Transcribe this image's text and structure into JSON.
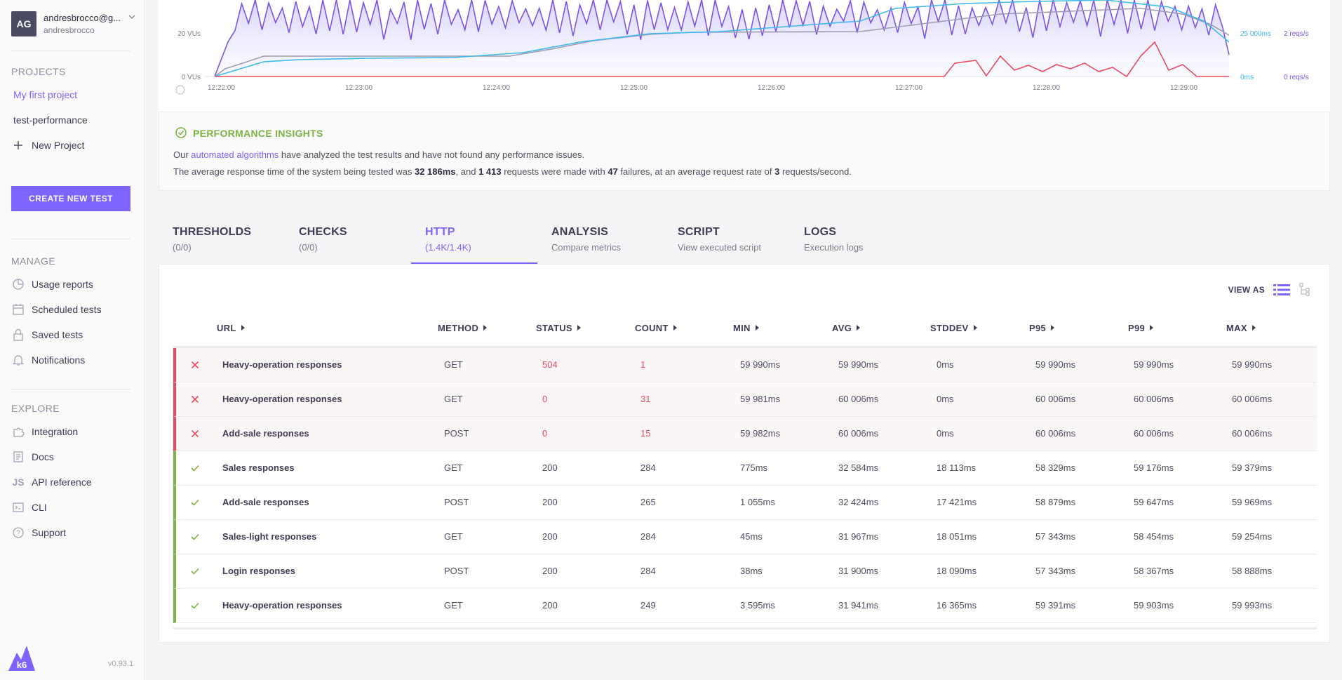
{
  "user": {
    "initials": "AG",
    "email": "andresbrocco@g...",
    "username": "andresbrocco"
  },
  "sidebar": {
    "projects_title": "PROJECTS",
    "projects": [
      {
        "label": "My first project",
        "active": true
      },
      {
        "label": "test-performance",
        "active": false
      }
    ],
    "new_project": "New Project",
    "create_button": "CREATE NEW TEST",
    "manage_title": "MANAGE",
    "manage": [
      {
        "label": "Usage reports",
        "icon": "usage-reports-icon"
      },
      {
        "label": "Scheduled tests",
        "icon": "calendar-icon"
      },
      {
        "label": "Saved tests",
        "icon": "lock-icon"
      },
      {
        "label": "Notifications",
        "icon": "bell-icon"
      }
    ],
    "explore_title": "EXPLORE",
    "explore": [
      {
        "label": "Integration",
        "icon": "puzzle-icon"
      },
      {
        "label": "Docs",
        "icon": "docs-icon"
      },
      {
        "label": "API reference",
        "icon": "js-icon"
      },
      {
        "label": "CLI",
        "icon": "terminal-icon"
      },
      {
        "label": "Support",
        "icon": "question-icon"
      }
    ],
    "version": "v0.93.1",
    "logo_text": "k6"
  },
  "chart": {
    "y_left_ticks": [
      "20 VUs",
      "0 VUs"
    ],
    "x_ticks": [
      "12:22:00",
      "12:23:00",
      "12:24:00",
      "12:25:00",
      "12:26:00",
      "12:27:00",
      "12:28:00",
      "12:29:00"
    ],
    "right_ticks_ms": [
      "25 000ms",
      "0ms"
    ],
    "right_ticks_reqs": [
      "2 reqs/s",
      "0 reqs/s"
    ],
    "colors": {
      "vus": "#9e9cae",
      "response_time": "#3fb8f0",
      "reqs": "#7d52e8",
      "failures": "#e84b5f"
    }
  },
  "insights": {
    "title": "PERFORMANCE INSIGHTS",
    "line1_pre": "Our ",
    "line1_link": "automated algorithms",
    "line1_post": " have analyzed the test results and have not found any performance issues.",
    "line2_a": "The average response time of the system being tested was ",
    "line2_b": "32 186ms",
    "line2_c": ", and ",
    "line2_d": "1 413",
    "line2_e": " requests were made with ",
    "line2_f": "47",
    "line2_g": " failures, at an average request rate of ",
    "line2_h": "3",
    "line2_i": " requests/second."
  },
  "tabs": [
    {
      "title": "THRESHOLDS",
      "sub": "(0/0)"
    },
    {
      "title": "CHECKS",
      "sub": "(0/0)"
    },
    {
      "title": "HTTP",
      "sub": "(1.4K/1.4K)"
    },
    {
      "title": "ANALYSIS",
      "sub": "Compare metrics"
    },
    {
      "title": "SCRIPT",
      "sub": "View executed script"
    },
    {
      "title": "LOGS",
      "sub": "Execution logs"
    }
  ],
  "table": {
    "view_as": "VIEW AS",
    "columns": [
      "URL",
      "METHOD",
      "STATUS",
      "COUNT",
      "MIN",
      "AVG",
      "STDDEV",
      "P95",
      "P99",
      "MAX"
    ],
    "rows": [
      {
        "ok": false,
        "url": "Heavy-operation responses",
        "method": "GET",
        "status": "504",
        "count": "1",
        "min": "59 990ms",
        "avg": "59 990ms",
        "stddev": "0ms",
        "p95": "59 990ms",
        "p99": "59 990ms",
        "max": "59 990ms"
      },
      {
        "ok": false,
        "url": "Heavy-operation responses",
        "method": "GET",
        "status": "0",
        "count": "31",
        "min": "59 981ms",
        "avg": "60 006ms",
        "stddev": "0ms",
        "p95": "60 006ms",
        "p99": "60 006ms",
        "max": "60 006ms"
      },
      {
        "ok": false,
        "url": "Add-sale responses",
        "method": "POST",
        "status": "0",
        "count": "15",
        "min": "59 982ms",
        "avg": "60 006ms",
        "stddev": "0ms",
        "p95": "60 006ms",
        "p99": "60 006ms",
        "max": "60 006ms"
      },
      {
        "ok": true,
        "url": "Sales responses",
        "method": "GET",
        "status": "200",
        "count": "284",
        "min": "775ms",
        "avg": "32 584ms",
        "stddev": "18 113ms",
        "p95": "58 329ms",
        "p99": "59 176ms",
        "max": "59 379ms"
      },
      {
        "ok": true,
        "url": "Add-sale responses",
        "method": "POST",
        "status": "200",
        "count": "265",
        "min": "1 055ms",
        "avg": "32 424ms",
        "stddev": "17 421ms",
        "p95": "58 879ms",
        "p99": "59 647ms",
        "max": "59 969ms"
      },
      {
        "ok": true,
        "url": "Sales-light responses",
        "method": "GET",
        "status": "200",
        "count": "284",
        "min": "45ms",
        "avg": "31 967ms",
        "stddev": "18 051ms",
        "p95": "57 343ms",
        "p99": "58 454ms",
        "max": "59 254ms"
      },
      {
        "ok": true,
        "url": "Login responses",
        "method": "POST",
        "status": "200",
        "count": "284",
        "min": "38ms",
        "avg": "31 900ms",
        "stddev": "18 090ms",
        "p95": "57 343ms",
        "p99": "58 367ms",
        "max": "58 888ms"
      },
      {
        "ok": true,
        "url": "Heavy-operation responses",
        "method": "GET",
        "status": "200",
        "count": "249",
        "min": "3 595ms",
        "avg": "31 941ms",
        "stddev": "16 365ms",
        "p95": "59 391ms",
        "p99": "59 903ms",
        "max": "59 993ms"
      }
    ]
  }
}
